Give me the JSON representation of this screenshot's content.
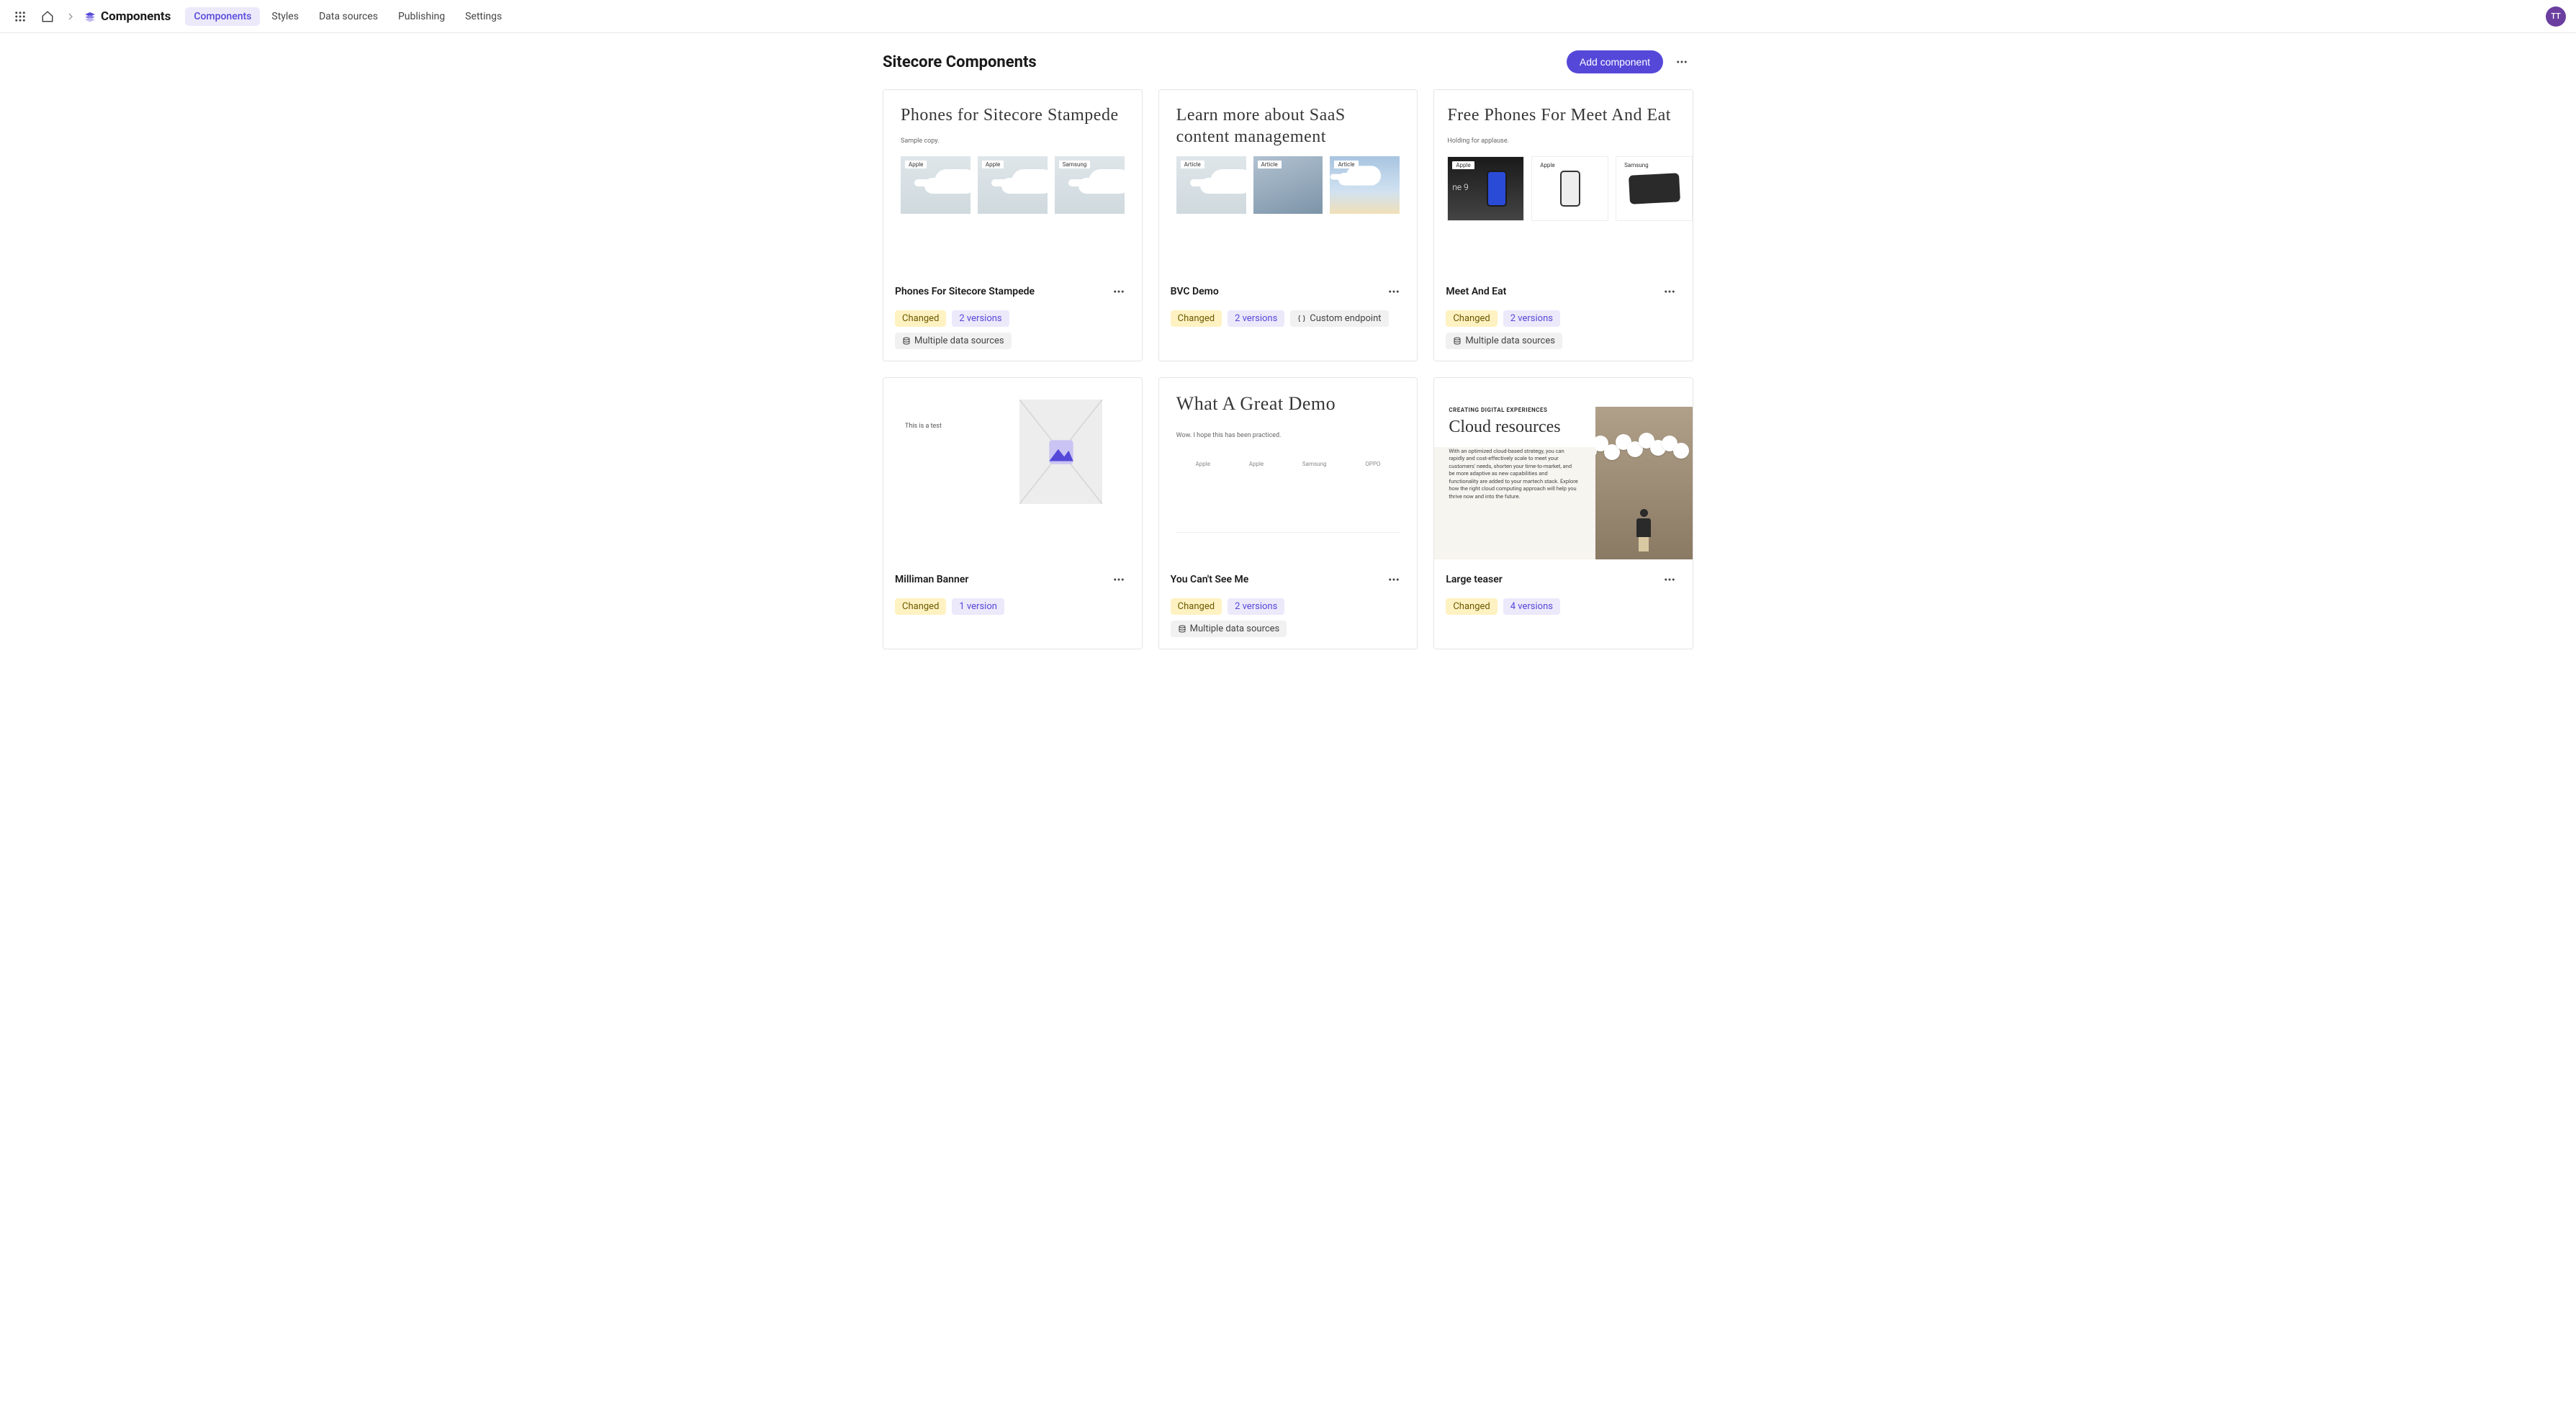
{
  "nav": {
    "brand": "Components",
    "tabs": [
      "Components",
      "Styles",
      "Data sources",
      "Publishing",
      "Settings"
    ],
    "active_tab_index": 0,
    "avatar_initials": "TT"
  },
  "page": {
    "title": "Sitecore Components",
    "add_button": "Add component"
  },
  "badge_labels": {
    "changed": "Changed",
    "multiple_ds": "Multiple data sources",
    "custom_ep": "Custom endpoint"
  },
  "cards": [
    {
      "title": "Phones For Sitecore Stampede",
      "status": "Changed",
      "versions": "2 versions",
      "datasource": "Multiple data sources",
      "ds_icon": "db",
      "preview": {
        "heading": "Phones for Sitecore Stampede",
        "sub": "Sample copy.",
        "tags": [
          "Apple",
          "Apple",
          "Samsung"
        ]
      }
    },
    {
      "title": "BVC Demo",
      "status": "Changed",
      "versions": "2 versions",
      "datasource": "Custom endpoint",
      "ds_icon": "braces",
      "preview": {
        "heading": "Learn more about SaaS content management",
        "tags": [
          "Article",
          "Article",
          "Article"
        ]
      }
    },
    {
      "title": "Meet And Eat",
      "status": "Changed",
      "versions": "2 versions",
      "datasource": "Multiple data sources",
      "ds_icon": "db",
      "preview": {
        "heading": "Free Phones For Meet And Eat",
        "sub": "Holding for applause.",
        "tags": [
          "Apple",
          "Apple",
          "Samsung"
        ],
        "extra": "ne 9"
      }
    },
    {
      "title": "Milliman Banner",
      "status": "Changed",
      "versions": "1 version",
      "preview": {
        "left_text": "This is a test"
      }
    },
    {
      "title": "You Can't See Me",
      "status": "Changed",
      "versions": "2 versions",
      "datasource": "Multiple data sources",
      "ds_icon": "db",
      "preview": {
        "heading": "What A Great Demo",
        "sub": "Wow. I hope this has been practiced.",
        "brands": [
          "Apple",
          "Apple",
          "Samsung",
          "OPPO"
        ]
      }
    },
    {
      "title": "Large teaser",
      "status": "Changed",
      "versions": "4 versions",
      "preview": {
        "eyebrow": "CREATING DIGITAL EXPERIENCES",
        "heading": "Cloud resources",
        "body": "With an optimized cloud-based strategy, you can rapidly and cost-effectively scale to meet your customers' needs, shorten your time-to-market, and be more adaptive as new capabilities and functionality are added to your martech stack. Explore how the right cloud computing approach will help you thrive now and into the future."
      }
    }
  ]
}
